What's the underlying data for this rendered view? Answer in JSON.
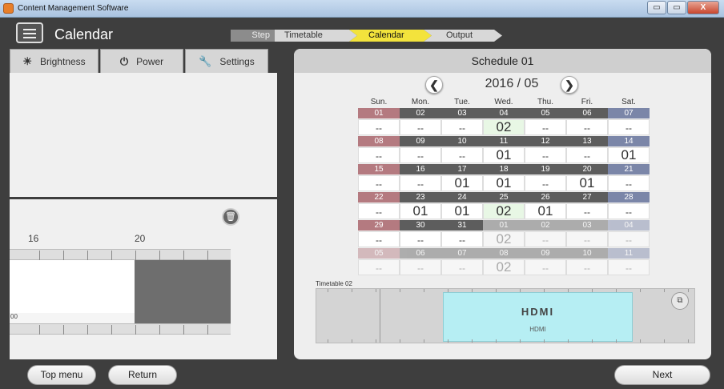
{
  "window": {
    "title": "Content Management Software",
    "buttons": [
      "▭",
      "▭",
      "X"
    ]
  },
  "header": {
    "page_title": "Calendar"
  },
  "steps": {
    "label": "Step",
    "items": [
      "Timetable",
      "Calendar",
      "Output"
    ],
    "active": "Calendar"
  },
  "left_tabs": [
    {
      "label": "Brightness",
      "icon": "sun-icon",
      "glyph": "☀"
    },
    {
      "label": "Power",
      "icon": "power-icon",
      "glyph": "⏻"
    },
    {
      "label": "Settings",
      "icon": "wrench-icon",
      "glyph": "🔧"
    }
  ],
  "left_timeline": {
    "hours": [
      "16",
      "20"
    ],
    "strip_text": "00"
  },
  "schedule": {
    "title": "Schedule 01",
    "month": "2016 / 05",
    "prev": "❮",
    "next": "❯",
    "weekdays": [
      "Sun.",
      "Mon.",
      "Tue.",
      "Wed.",
      "Thu.",
      "Fri.",
      "Sat."
    ],
    "weeks": [
      [
        {
          "d": "01",
          "v": "--"
        },
        {
          "d": "02",
          "v": "--"
        },
        {
          "d": "03",
          "v": "--"
        },
        {
          "d": "04",
          "v": "02",
          "hl": true
        },
        {
          "d": "05",
          "v": "--"
        },
        {
          "d": "06",
          "v": "--"
        },
        {
          "d": "07",
          "v": "--"
        }
      ],
      [
        {
          "d": "08",
          "v": "--"
        },
        {
          "d": "09",
          "v": "--"
        },
        {
          "d": "10",
          "v": "--"
        },
        {
          "d": "11",
          "v": "01"
        },
        {
          "d": "12",
          "v": "--"
        },
        {
          "d": "13",
          "v": "--"
        },
        {
          "d": "14",
          "v": "01"
        }
      ],
      [
        {
          "d": "15",
          "v": "--"
        },
        {
          "d": "16",
          "v": "--"
        },
        {
          "d": "17",
          "v": "01"
        },
        {
          "d": "18",
          "v": "01"
        },
        {
          "d": "19",
          "v": "--"
        },
        {
          "d": "20",
          "v": "01"
        },
        {
          "d": "21",
          "v": "--"
        }
      ],
      [
        {
          "d": "22",
          "v": "--"
        },
        {
          "d": "23",
          "v": "01"
        },
        {
          "d": "24",
          "v": "01"
        },
        {
          "d": "25",
          "v": "02",
          "hl": true
        },
        {
          "d": "26",
          "v": "01"
        },
        {
          "d": "27",
          "v": "--"
        },
        {
          "d": "28",
          "v": "--"
        }
      ],
      [
        {
          "d": "29",
          "v": "--"
        },
        {
          "d": "30",
          "v": "--"
        },
        {
          "d": "31",
          "v": "--"
        },
        {
          "d": "01",
          "v": "02",
          "next": true
        },
        {
          "d": "02",
          "v": "--",
          "next": true
        },
        {
          "d": "03",
          "v": "--",
          "next": true
        },
        {
          "d": "04",
          "v": "--",
          "next": true
        }
      ],
      [
        {
          "d": "05",
          "v": "--",
          "next": true
        },
        {
          "d": "06",
          "v": "--",
          "next": true
        },
        {
          "d": "07",
          "v": "--",
          "next": true
        },
        {
          "d": "08",
          "v": "02",
          "next": true
        },
        {
          "d": "09",
          "v": "--",
          "next": true
        },
        {
          "d": "10",
          "v": "--",
          "next": true
        },
        {
          "d": "11",
          "v": "--",
          "next": true
        }
      ]
    ],
    "timetable_label": "Timetable 02",
    "input_logo": "HDMI",
    "input_name": "HDMI"
  },
  "footer": {
    "top_menu": "Top menu",
    "return": "Return",
    "next": "Next"
  },
  "colors": {
    "sunday": "#b47a80",
    "saturday": "#7b86a8",
    "weekday": "#5d5d5d",
    "active_step": "#f3e33c",
    "hdmi_block": "#b6eef3"
  }
}
